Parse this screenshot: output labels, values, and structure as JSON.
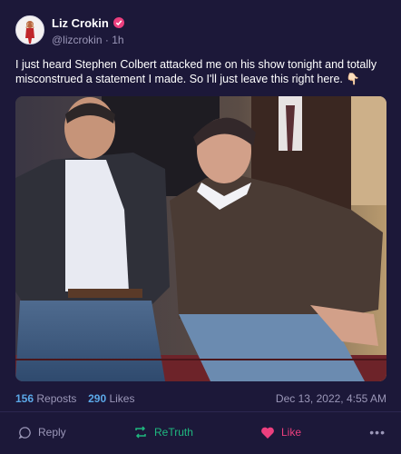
{
  "post": {
    "author_name": "Liz Crokin",
    "handle": "@lizcrokin",
    "separator": "·",
    "time_ago": "1h",
    "text": "I just heard Stephen Colbert attacked me on his show tonight and totally misconstrued a statement I made. So I'll just leave this right here. 👇🏻",
    "media_icon": "photo",
    "verified_icon": "verified-badge-icon"
  },
  "stats": {
    "reposts_count": "156",
    "reposts_label": "Reposts",
    "likes_count": "290",
    "likes_label": "Likes",
    "date": "Dec 13, 2022, 4:55 AM"
  },
  "actions": {
    "reply_label": "Reply",
    "retruth_label": "ReTruth",
    "like_label": "Like",
    "more_label": "•••"
  },
  "colors": {
    "background": "#1c1839",
    "accent_pink": "#ec3f7e",
    "accent_green": "#1fb87f",
    "accent_blue": "#5ba8e8",
    "muted": "#9b97b8"
  }
}
